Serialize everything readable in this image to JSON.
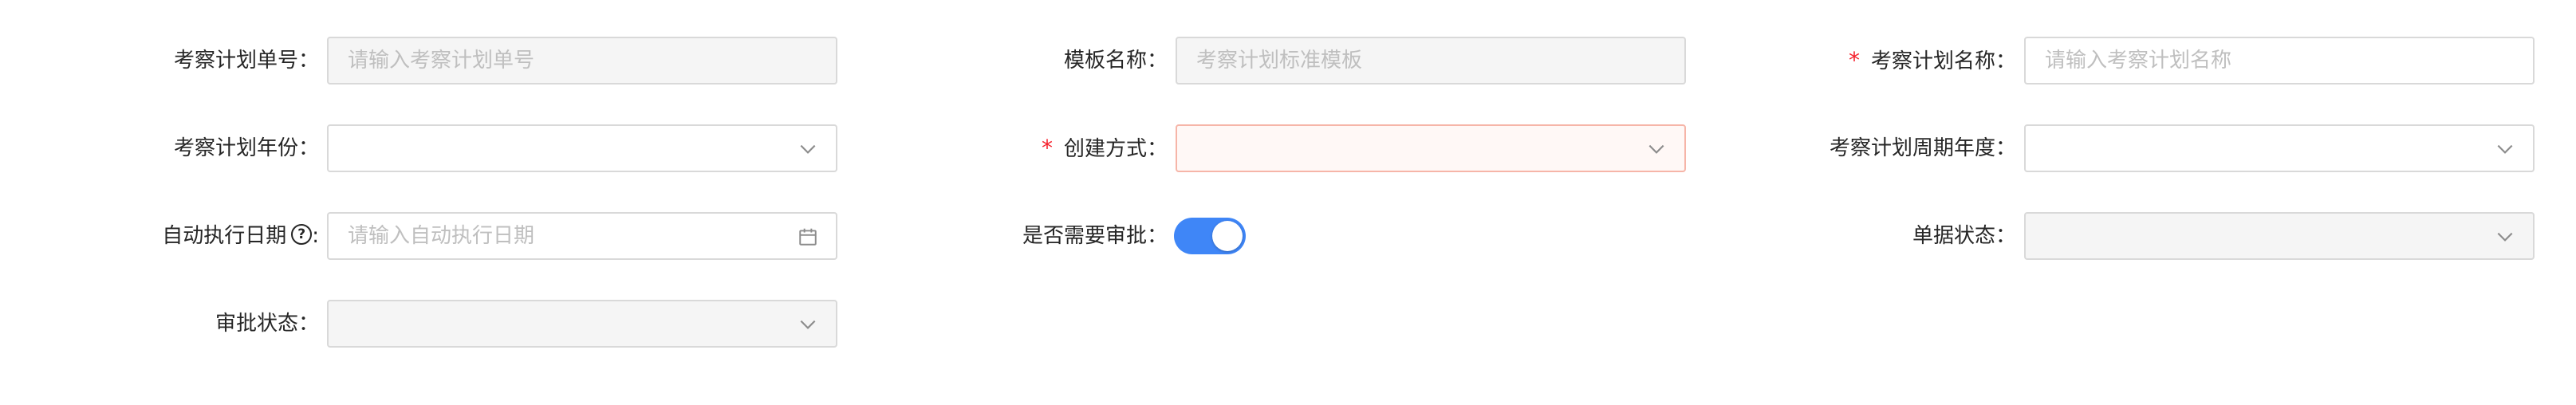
{
  "form": {
    "plan_no": {
      "label": "考察计划单号：",
      "placeholder": "请输入考察计划单号"
    },
    "template_name": {
      "label": "模板名称：",
      "placeholder": "考察计划标准模板"
    },
    "plan_name": {
      "required_mark": "*",
      "label": "考察计划名称：",
      "placeholder": "请输入考察计划名称"
    },
    "plan_year": {
      "label": "考察计划年份：",
      "value": ""
    },
    "create_method": {
      "required_mark": "*",
      "label": "创建方式：",
      "value": ""
    },
    "plan_period_year": {
      "label": "考察计划周期年度：",
      "value": ""
    },
    "auto_exec_date": {
      "label": "自动执行日期",
      "help": "?",
      "colon": ":",
      "placeholder": "请输入自动执行日期"
    },
    "need_approval": {
      "label": "是否需要审批：",
      "enabled": true
    },
    "doc_status": {
      "label": "单据状态：",
      "value": ""
    },
    "approval_status": {
      "label": "审批状态：",
      "value": ""
    }
  },
  "colors": {
    "accent": "#3f86f7",
    "required": "#f5222d",
    "error_border": "#f6b5a8",
    "disabled_bg": "#f5f5f5",
    "placeholder": "#bfbfbf"
  },
  "icons": {
    "select": "chevron-down-icon",
    "date": "calendar-icon",
    "help": "question-circle-icon"
  }
}
